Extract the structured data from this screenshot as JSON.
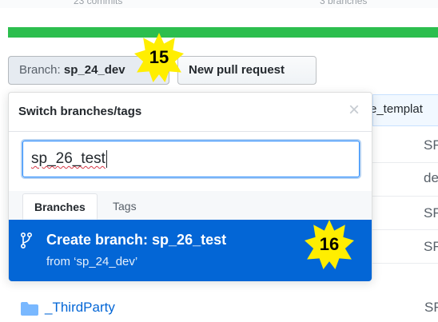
{
  "header": {
    "hidden_left": "23 commits",
    "hidden_right": "3 branches",
    "language_bar_fill": 1.0,
    "language_bar_color": "#2cbe4e"
  },
  "toolbar": {
    "branch_prefix": "Branch:",
    "branch_name": "sp_24_dev",
    "new_pull_request_label": "New pull request"
  },
  "annotations": {
    "step_a": "15",
    "step_b": "16",
    "badge_color": "#ffee00"
  },
  "dropdown": {
    "title": "Switch branches/tags",
    "close_icon": "close-icon",
    "filter_value": "sp_26_test",
    "tabs": [
      {
        "label": "Branches",
        "selected": true
      },
      {
        "label": "Tags",
        "selected": false
      }
    ],
    "create": {
      "title": "Create branch: sp_26_test",
      "subtitle": "from ‘sp_24_dev’",
      "icon": "git-branch-icon",
      "background": "#0366d6"
    }
  },
  "file_list": {
    "header_text": "e_templat",
    "rows": [
      {
        "sha": "SF"
      },
      {
        "sha": "de"
      },
      {
        "sha": "SF"
      },
      {
        "sha": "SF"
      }
    ],
    "third_party": {
      "name": "_ThirdParty",
      "sha": "SF",
      "icon": "folder-icon"
    }
  }
}
